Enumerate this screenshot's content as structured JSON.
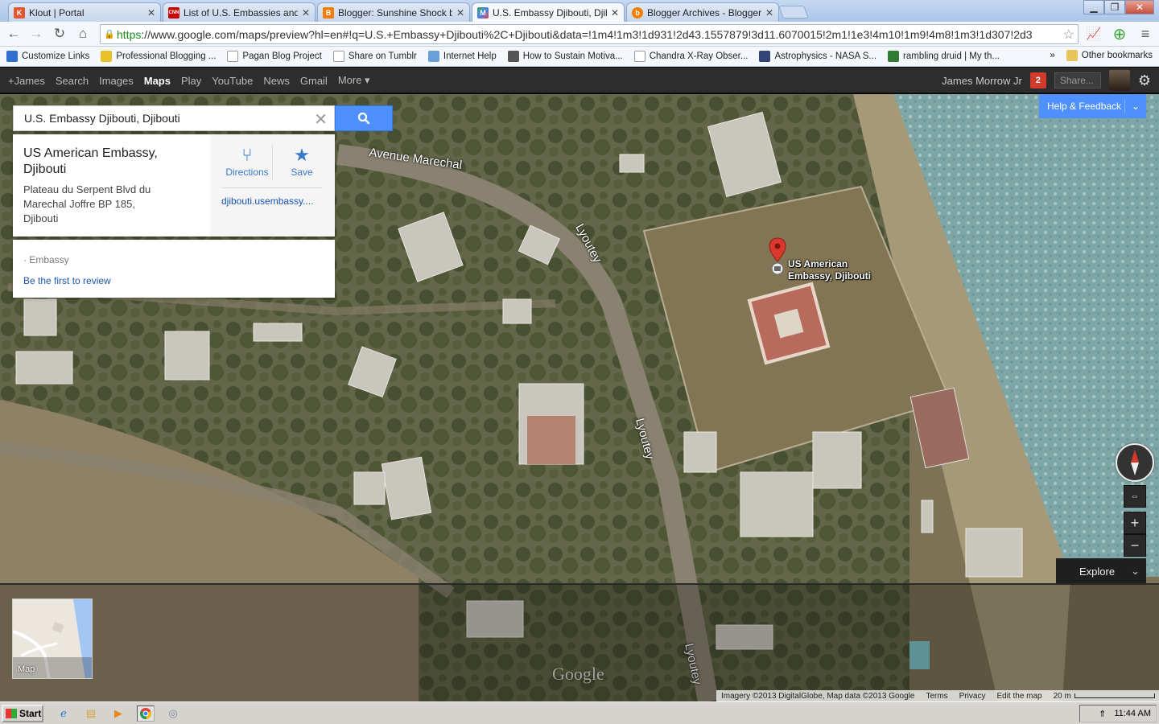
{
  "browser": {
    "tabs": [
      {
        "label": "Klout | Portal",
        "favicon_color": "#e4572e",
        "favicon_text": "K"
      },
      {
        "label": "List of U.S. Embassies and co",
        "favicon_color": "#cc0000",
        "favicon_text": "CNN"
      },
      {
        "label": "Blogger: Sunshine Shock by",
        "favicon_color": "#f57d00",
        "favicon_text": "B"
      },
      {
        "label": "U.S. Embassy Djibouti, Djibo",
        "favicon_color": "#34a853",
        "favicon_text": "M"
      },
      {
        "label": "Blogger Archives - Blogger Ti",
        "favicon_color": "#f57d00",
        "favicon_text": "b"
      }
    ],
    "url_proto": "https",
    "url_rest": "://www.google.com/maps/preview?hl=en#!q=U.S.+Embassy+Djibouti%2C+Djibouti&data=!1m4!1m3!1d931!2d43.1557879!3d11.6070015!2m1!1e3!4m10!1m9!4m8!1m3!1d307!2d3",
    "bookmarks": [
      {
        "label": "Customize Links",
        "color": "#2f6fd1"
      },
      {
        "label": "Professional Blogging ...",
        "color": "#e8c22a"
      },
      {
        "label": "Pagan Blog Project",
        "color": "#dddddd"
      },
      {
        "label": "Share on Tumblr",
        "color": "#dddddd"
      },
      {
        "label": "Internet Help",
        "color": "#6aa0d8"
      },
      {
        "label": "How to Sustain Motiva...",
        "color": "#555555"
      },
      {
        "label": "Chandra X-Ray Obser...",
        "color": "#dddddd"
      },
      {
        "label": "Astrophysics - NASA S...",
        "color": "#334477"
      },
      {
        "label": "rambling druid | My th...",
        "color": "#2e7d32"
      }
    ],
    "bookmarks_overflow": "»",
    "other_bookmarks": "Other bookmarks"
  },
  "gbar": {
    "links": [
      "+James",
      "Search",
      "Images",
      "Maps",
      "Play",
      "YouTube",
      "News",
      "Gmail",
      "More ▾"
    ],
    "active": "Maps",
    "user": "James Morrow Jr",
    "notifications": "2",
    "share": "Share..."
  },
  "maps": {
    "search_value": "U.S. Embassy Djibouti, Djibouti",
    "place": {
      "title": "US American Embassy, Djibouti",
      "address_lines": [
        "Plateau du Serpent Blvd du",
        "Marechal Joffre BP 185,",
        "Djibouti"
      ],
      "directions": "Directions",
      "save": "Save",
      "website": "djibouti.usembassy...."
    },
    "category": "· Embassy",
    "review_link": "Be the first to review",
    "help": "Help & Feedback",
    "marker_label_1": "US American",
    "marker_label_2": "Embassy, Djibouti",
    "roads": {
      "avenue": "Avenue Marechal",
      "lyoutey": "Lyoutey"
    },
    "explore": "Explore",
    "thumb_label": "Map",
    "logo": "Google",
    "attribution": [
      "Imagery ©2013 DigitalGlobe, Map data ©2013 Google",
      "Terms",
      "Privacy",
      "Edit the map"
    ],
    "scale": "20 m"
  },
  "taskbar": {
    "start": "Start",
    "time": "11:44 AM"
  }
}
